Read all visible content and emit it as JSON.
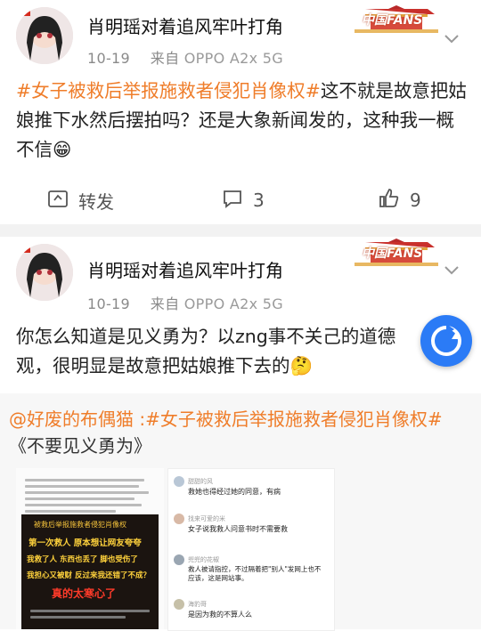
{
  "post1": {
    "username": "肖明瑶对着追风牢叶打角",
    "date": "10-19",
    "source_prefix": "来自",
    "device": "OPPO A2x 5G",
    "tag": "#女子被救后举报施救者侵犯肖像权#",
    "text": "这不就是故意把姑娘推下水然后摆拍吗？还是大象新闻发的，这种我一概不信",
    "emoji": "😁",
    "badge_text": "中国FANS",
    "actions": {
      "repost_label": "转发",
      "comment_count": "3",
      "like_count": "9"
    }
  },
  "post2": {
    "username": "肖明瑶对着追风牢叶打角",
    "date": "10-19",
    "source_prefix": "来自",
    "device": "OPPO A2x 5G",
    "text": "你怎么知道是见义勇为？以zng事不关己的道德观，很明显是故意把姑娘推下去的",
    "emoji": "🤔",
    "badge_text": "中国FANS"
  },
  "quote": {
    "mention": "@好废的布偶猫",
    "colon": " :",
    "tag": "#女子被救后举报施救者侵犯肖像权#",
    "line2": "《不要见义勇为》",
    "left_image": {
      "caption_lines": [
        "被救后举报施救者侵犯肖像权",
        "第一次救人 原本想让网友夸夸",
        "我救了人 东西也丢了 脚也受伤了",
        "我担心又被财 反过来我还错了不成？",
        "真的太寒心了"
      ]
    },
    "right_image": {
      "comments": [
        {
          "user": "甜甜的风",
          "text": "救她也得经过她的同意，有病"
        },
        {
          "user": "找来可爱的米",
          "text": "女子说我救人问意书时不需要救"
        },
        {
          "user": "兜兜的花椒",
          "text": "救人被请指控，不过隔着把\"别人\"发网上也不应该，这是网站事。"
        },
        {
          "user": "海豹哥",
          "text": "是因为救的不算人么"
        }
      ]
    }
  },
  "colors": {
    "tag": "#ef7d2a",
    "meta": "#8a8a8a",
    "fab": "#2b7bf6",
    "separator": "#f2f2f2"
  }
}
